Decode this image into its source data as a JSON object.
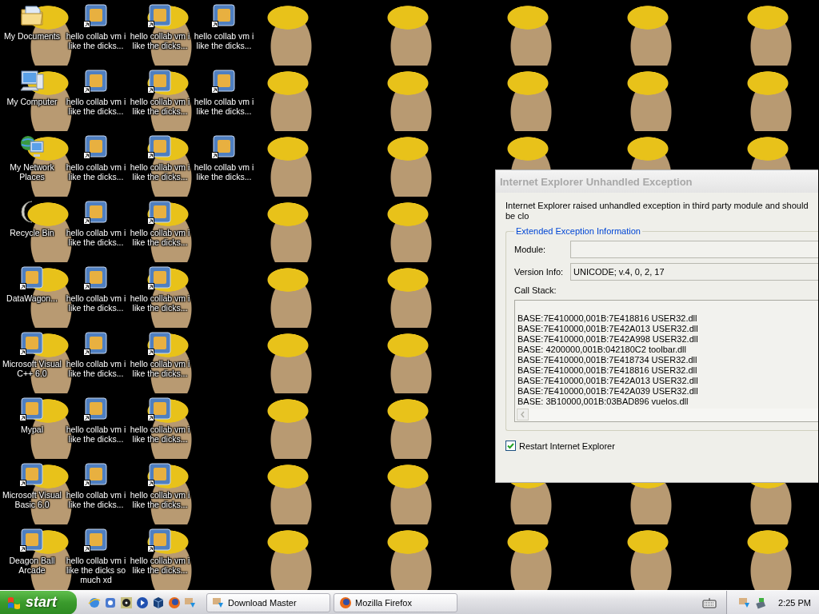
{
  "desktop": {
    "icons": [
      {
        "kind": "folder",
        "label": "My Documents",
        "shortcut": false
      },
      {
        "kind": "computer",
        "label": "My Computer",
        "shortcut": false
      },
      {
        "kind": "network",
        "label": "My Network Places",
        "shortcut": false
      },
      {
        "kind": "recycle",
        "label": "Recycle Bin",
        "shortcut": false
      },
      {
        "kind": "app",
        "label": "DataWagon...",
        "shortcut": true
      },
      {
        "kind": "app",
        "label": "Microsoft Visual C++ 6.0",
        "shortcut": true
      },
      {
        "kind": "app",
        "label": "Mypal",
        "shortcut": true
      },
      {
        "kind": "app",
        "label": "Microsoft Visual Basic 6.0",
        "shortcut": true
      },
      {
        "kind": "app",
        "label": "Deagon Ball Arcade",
        "shortcut": true
      },
      {
        "kind": "app",
        "label": "hello collab vm i like the dicks...",
        "shortcut": true
      },
      {
        "kind": "app",
        "label": "hello collab vm i like the dicks...",
        "shortcut": true
      },
      {
        "kind": "app",
        "label": "hello collab vm i like the dicks...",
        "shortcut": true
      },
      {
        "kind": "app",
        "label": "hello collab vm i like the dicks...",
        "shortcut": true
      },
      {
        "kind": "app",
        "label": "hello collab vm i like the dicks...",
        "shortcut": true
      },
      {
        "kind": "app",
        "label": "hello collab vm i like the dicks...",
        "shortcut": true
      },
      {
        "kind": "app",
        "label": "hello collab vm i like the dicks...",
        "shortcut": true
      },
      {
        "kind": "app",
        "label": "hello collab vm i like the dicks...",
        "shortcut": true
      },
      {
        "kind": "app",
        "label": "hello collab vm i like the dicks so much xd",
        "shortcut": true
      },
      {
        "kind": "app",
        "label": "hello collab vm i like the dicks...",
        "shortcut": true
      },
      {
        "kind": "app",
        "label": "hello collab vm i like the dicks...",
        "shortcut": true
      },
      {
        "kind": "app",
        "label": "hello collab vm i like the dicks...",
        "shortcut": true
      },
      {
        "kind": "app",
        "label": "hello collab vm i like the dicks...",
        "shortcut": true
      },
      {
        "kind": "app",
        "label": "hello collab vm i like the dicks...",
        "shortcut": true
      },
      {
        "kind": "app",
        "label": "hello collab vm i like the dicks...",
        "shortcut": true
      },
      {
        "kind": "app",
        "label": "hello collab vm i like the dicks...",
        "shortcut": true
      },
      {
        "kind": "app",
        "label": "hello collab vm i like the dicks...",
        "shortcut": true
      },
      {
        "kind": "app",
        "label": "hello collab vm i like the dicks...",
        "shortcut": true
      },
      {
        "kind": "app",
        "label": "hello collab vm i like the dicks...",
        "shortcut": true
      },
      {
        "kind": "app",
        "label": "hello collab vm i like the dicks...",
        "shortcut": true
      },
      {
        "kind": "app",
        "label": "hello collab vm i like the dicks...",
        "shortcut": true
      }
    ]
  },
  "dialog": {
    "title": "Internet Explorer Unhandled Exception",
    "active": false,
    "message": "Internet Explorer raised unhandled exception in third party module and should be clo",
    "group_title": "Extended Exception Information",
    "fields": [
      {
        "label": "Module:"
      },
      {
        "label": "Version Info:",
        "value": "UNICODE; v.4, 0, 2, 17"
      }
    ],
    "call_stack_label": "Call Stack:",
    "call_stack": [
      "BASE:7E410000,001B:7E418816 USER32.dll",
      "BASE:7E410000,001B:7E42A013 USER32.dll",
      "BASE:7E410000,001B:7E42A998 USER32.dll",
      "BASE: 4200000,001B:042180C2 toolbar.dll",
      "BASE:7E410000,001B:7E418734 USER32.dll",
      "BASE:7E410000,001B:7E418816 USER32.dll",
      "BASE:7E410000,001B:7E42A013 USER32.dll",
      "BASE:7E410000,001B:7E42A039 USER32.dll",
      "BASE: 3B10000,001B:03BAD896 vuelos.dll"
    ],
    "restart": {
      "label": "Restart Internet Explorer",
      "checked": true
    }
  },
  "taskbar": {
    "start_label": "start",
    "tasks": [
      {
        "label": "Download Master",
        "selected": false
      },
      {
        "label": "Mozilla Firefox",
        "selected": false
      }
    ],
    "clock": "2:25 PM"
  }
}
